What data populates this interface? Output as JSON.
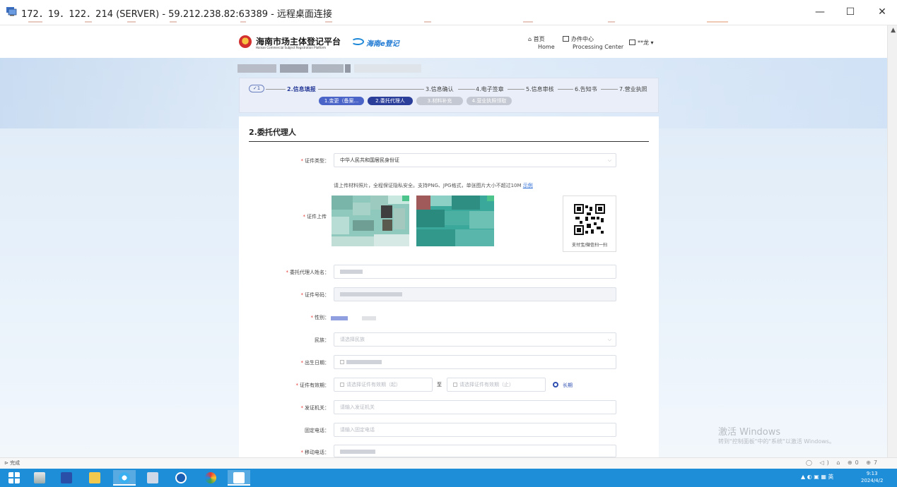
{
  "window": {
    "title": "172．19．122．214 (SERVER) - 59.212.238.82:63389 - 远程桌面连接",
    "minimize": "—",
    "maximize": "☐",
    "close": "✕"
  },
  "header": {
    "logo_cn": "海南市场主体登记平台",
    "logo_en": "Hainan Commercial Subject Registration Platform",
    "logo2": "海南e登记",
    "nav": [
      {
        "cn": "首页",
        "en": "Home"
      },
      {
        "cn": "办件中心",
        "en": "Processing Center"
      },
      {
        "cn": "**龙",
        "en": ""
      }
    ]
  },
  "steps": {
    "items": [
      "1",
      "2.信息填报",
      "3.信息确认",
      "4.电子签章",
      "5.信息审核",
      "6.告知书",
      "7.营业执照"
    ],
    "check_mark": "✓",
    "sub": [
      "1.变更（备案...",
      "2.委托代理人",
      "3.材料补充",
      "4.营业执照领取"
    ]
  },
  "form": {
    "title": "2.委托代理人",
    "id_type_label": "证件类型：",
    "id_type_value": "中华人民共和国居民身份证",
    "upload_hint": "请上传材料照片，全程保证隐私安全。支持PNG、JPG格式，单张图片大小不超过10M",
    "upload_example": "示例",
    "upload_label": "证件上传",
    "qr_caption": "支付宝/微信扫一扫",
    "name_label": "委托代理人姓名：",
    "idno_label": "证件号码：",
    "gender_label": "性别：",
    "ethnic_label": "民族：",
    "ethnic_placeholder": "请选择民族",
    "birth_label": "出生日期：",
    "validity_label": "证件有效期：",
    "validity_start_placeholder": "请选择证件有效期（起）",
    "validity_to": "至",
    "validity_end_placeholder": "请选择证件有效期（止）",
    "long_term": "长期",
    "issuer_label": "发证机关：",
    "issuer_placeholder": "请输入发证机关",
    "phone_label": "固定电话：",
    "phone_placeholder": "请输入固定电话",
    "mobile_label": "移动电话："
  },
  "watermark": {
    "line1": "激活 Windows",
    "line2": "转到\"控制面板\"中的\"系统\"以激活 Windows。"
  },
  "statusbar": {
    "text": "完成",
    "icons": "◯ ◁) ⌂ ⊕0 ⊕7"
  },
  "taskbar": {
    "time": "9:13",
    "date": "2024/4/2",
    "tray": "▲"
  },
  "colors": {
    "accent": "#2b3e9a",
    "pill_active": "#2f4fb0",
    "pill_inactive": "#c4c8d2",
    "taskbar": "#1f8ed8"
  }
}
